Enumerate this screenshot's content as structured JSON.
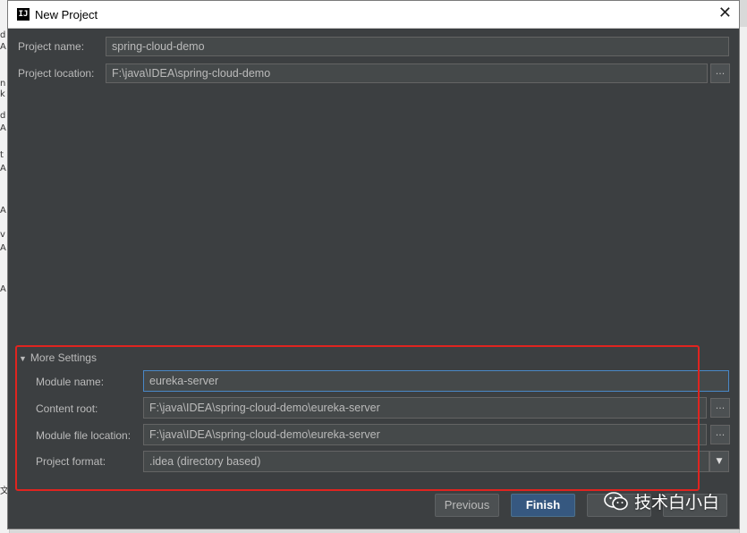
{
  "background_window": {
    "letters": [
      "d",
      "A",
      "n",
      "k",
      "d",
      "A",
      "t",
      "A",
      "A",
      "v",
      "A",
      "A",
      "文"
    ]
  },
  "window": {
    "title": "New Project",
    "app_icon": "IJ"
  },
  "project": {
    "name_label": "Project name:",
    "name_value": "spring-cloud-demo",
    "location_label": "Project location:",
    "location_value": "F:\\java\\IDEA\\spring-cloud-demo",
    "browse_label": "..."
  },
  "more_settings": {
    "label": "More Settings",
    "module_name_label": "Module name:",
    "module_name_value": "eureka-server",
    "content_root_label": "Content root:",
    "content_root_value": "F:\\java\\IDEA\\spring-cloud-demo\\eureka-server",
    "module_file_label": "Module file location:",
    "module_file_value": "F:\\java\\IDEA\\spring-cloud-demo\\eureka-server",
    "project_format_label": "Project format:",
    "project_format_value": ".idea (directory based)",
    "browse_label": "..."
  },
  "buttons": {
    "previous": "Previous",
    "finish": "Finish"
  },
  "watermark": {
    "text": "技术白小白",
    "icon": "wechat-icon"
  },
  "colors": {
    "dialog_bg": "#3c3f41",
    "field_bg": "#45494a",
    "focus_border": "#4a88c7",
    "highlight_box": "#e0241f",
    "primary_button": "#365880"
  }
}
